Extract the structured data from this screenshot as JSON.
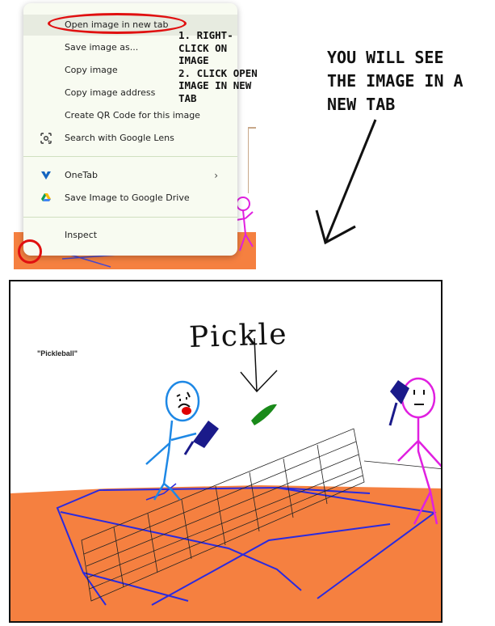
{
  "context_menu": {
    "items": [
      {
        "label": "Open image in new tab",
        "icon": ""
      },
      {
        "label": "Save image as...",
        "icon": ""
      },
      {
        "label": "Copy image",
        "icon": ""
      },
      {
        "label": "Copy image address",
        "icon": ""
      },
      {
        "label": "Create QR Code for this image",
        "icon": ""
      },
      {
        "label": "Search with Google Lens",
        "icon": "google-lens-icon"
      },
      {
        "label": "OneTab",
        "icon": "onetab-icon"
      },
      {
        "label": "Save Image to Google Drive",
        "icon": "google-drive-icon"
      },
      {
        "label": "Inspect",
        "icon": ""
      }
    ]
  },
  "annotations": {
    "steps": "1. RIGHT-\nCLICK ON\nIMAGE\n2. CLICK OPEN\nIMAGE IN NEW\nTAB",
    "tip": "YOU WILL SEE\nTHE IMAGE IN A\nNEW TAB"
  },
  "drawing": {
    "caption": "\"Pickleball\"",
    "pickle_word": "Pickle"
  },
  "colors": {
    "highlight": "#e01010",
    "court": "#f58040",
    "court_lines": "#2a2adf",
    "player_left": "#1e88e5",
    "player_right": "#e020e0",
    "pickle": "#1a8a1a",
    "paddle": "#1a1a8a"
  }
}
